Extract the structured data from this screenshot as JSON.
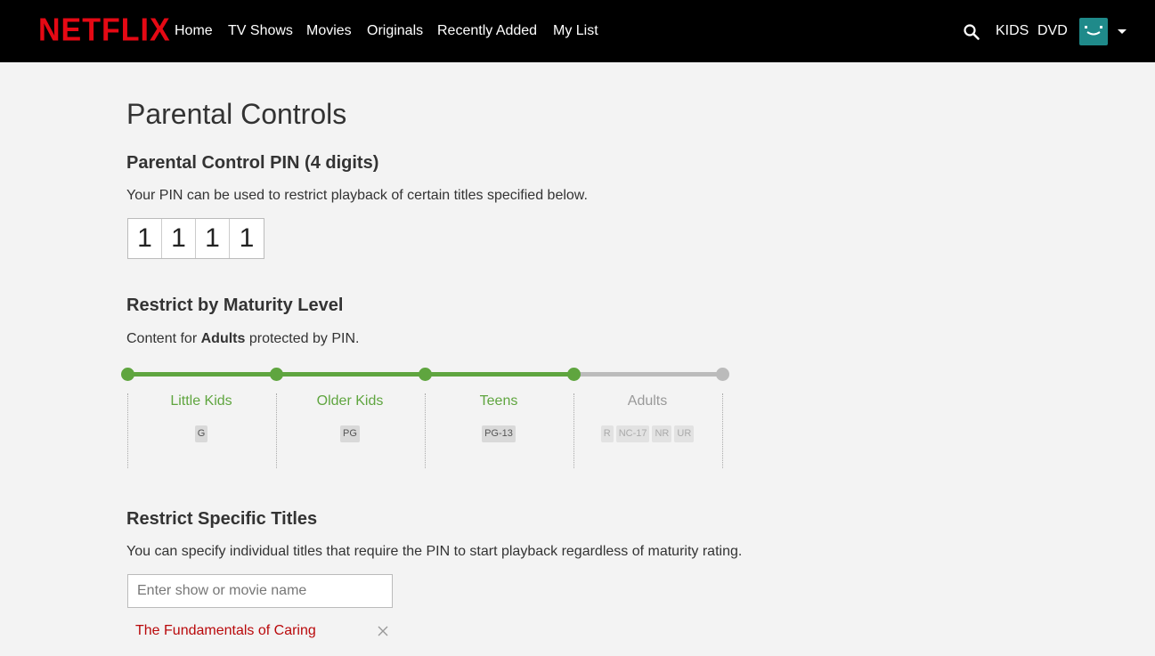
{
  "header": {
    "logo": "NETFLIX",
    "nav": [
      "Home",
      "TV Shows",
      "Movies",
      "Originals",
      "Recently Added",
      "My List"
    ],
    "kids": "KIDS",
    "dvd": "DVD",
    "search_icon": "search-icon",
    "avatar_icon": "smiley-avatar-icon"
  },
  "page": {
    "title": "Parental Controls"
  },
  "pin": {
    "heading": "Parental Control PIN (4 digits)",
    "description": "Your PIN can be used to restrict playback of certain titles specified below.",
    "digits": [
      "1",
      "1",
      "1",
      "1"
    ]
  },
  "maturity": {
    "heading": "Restrict by Maturity Level",
    "desc_prefix": "Content for ",
    "desc_level": "Adults",
    "desc_suffix": " protected by PIN.",
    "active_color": "#5fa53f",
    "inactive_color": "#bbbbbb",
    "levels": [
      {
        "label": "Little Kids",
        "ratings": [
          "G"
        ]
      },
      {
        "label": "Older Kids",
        "ratings": [
          "PG"
        ]
      },
      {
        "label": "Teens",
        "ratings": [
          "PG-13"
        ]
      },
      {
        "label": "Adults",
        "ratings": [
          "R",
          "NC-17",
          "NR",
          "UR"
        ]
      }
    ]
  },
  "titles": {
    "heading": "Restrict Specific Titles",
    "description": "You can specify individual titles that require the PIN to start playback regardless of maturity rating.",
    "placeholder": "Enter show or movie name",
    "restricted": [
      "The Fundamentals of Caring"
    ]
  },
  "colors": {
    "brand": "#e50914",
    "restricted_title": "#b9090b",
    "avatar": "#1f8a8a"
  }
}
